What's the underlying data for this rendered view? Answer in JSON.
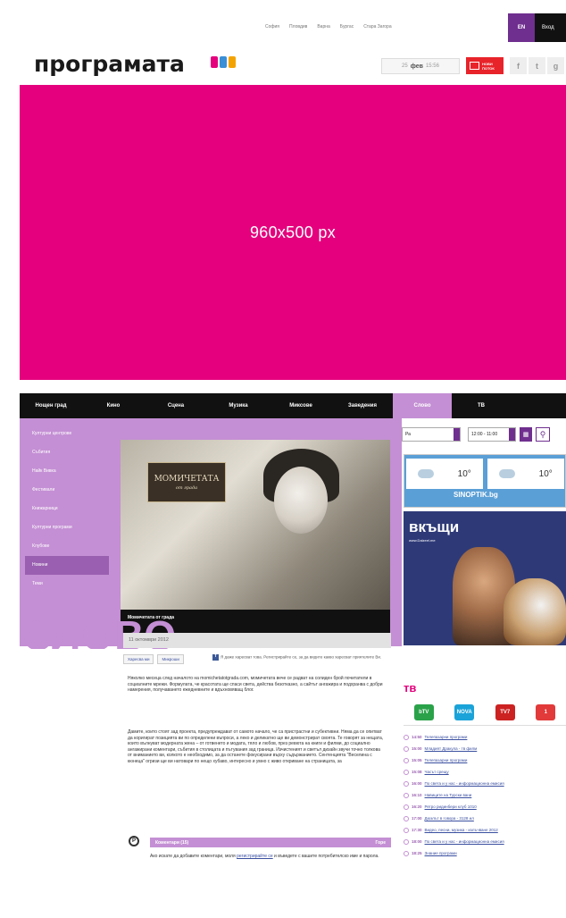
{
  "top_nav": {
    "links": [
      "София",
      "Пловдив",
      "Варна",
      "Бургас",
      "Стара Загора"
    ],
    "lang": "EN",
    "login": "Вход"
  },
  "header": {
    "logo": "програмата",
    "date_day": "25",
    "date_month": "фев",
    "date_time": "15:56",
    "news_label": "НОВИ ПОТОК",
    "social": [
      "f",
      "t",
      "g"
    ]
  },
  "banner": {
    "text": "960x500 px"
  },
  "main_nav": {
    "items": [
      {
        "label": "Нощен град",
        "w": 62
      },
      {
        "label": "Кино",
        "w": 60
      },
      {
        "label": "Сцена",
        "w": 60
      },
      {
        "label": "Музика",
        "w": 70
      },
      {
        "label": "Миксове",
        "w": 66
      },
      {
        "label": "Заведения",
        "w": 70
      },
      {
        "label": "Слово",
        "w": 66
      },
      {
        "label": "ТВ",
        "w": 70
      }
    ],
    "active": "Слово"
  },
  "section": {
    "big_word": "СЛОВО",
    "left_menu": [
      "Културни центрове",
      "Събития",
      "Найк Вивка",
      "Фестивали",
      "Книжарници",
      "Културни програми",
      "Клубове",
      "Новини",
      "Теми"
    ],
    "selected_menu": "Новини",
    "hero_sign_title": "МОМИЧЕТАТА",
    "hero_sign_sub": "от града",
    "hero_caption": "Момичетата от града"
  },
  "filter": {
    "select": "Ра",
    "time": "12:00 - 11:00"
  },
  "weather": {
    "temp1": "10°",
    "temp2": "10°",
    "brand": "SINOPTIK.bg"
  },
  "ad": {
    "title": "вкъщи",
    "site": "www.Dalzeel.me"
  },
  "article": {
    "date": "11 октомври 2012",
    "share_labels": [
      "Харесва ми",
      "Микроши"
    ],
    "fb_text": "Я даже харесват това. Регистрирайте се, за да видите какво харесват приятелите Ви.",
    "p1": "Няколко месеца след началото на momichetatotgrada.com, момичетата вече се радват на солиден брой почитатели в социалните мрежи. Формулата, че красотата ще спаси света, действа безотказно, а сайтът ангажира и подхранва с добри намерения, получаването ежедневните и вдъхновяващ блог.",
    "p2": "Дамите, които стоят зад проекта, предупреждават от самото начало, че са пристрастни и субективни. Няма да се опитват да коригират позицията ви по определени въпроси, а леко и деликатно ще ви демонстрират своята. Те говорят за нещата, които вълнуват модерната жена – от готвенето и модата, тяло и любов, през ревюта на книги и филми, до социално ангажирани коментари, събития в столицата и пътувания зад граница. Изчистеният и светъл дизайн звучи точно толкова от вниманието ви, колкото е необходимо, за да останете фокусирани върху съдържанието. Сентенцията \"Веселина с кюнеца\" огризи ще ви натовари по нещо хубаво, интересно и умно с живо откриване на страницата, за"
  },
  "comments": {
    "label": "Коментари (15)",
    "right": "Горе",
    "note_prefix": "Ако искате да добавите коментари, моля ",
    "note_link": "регистрирайте се",
    "note_suffix": " и въведете с вашите потребителско име и парола."
  },
  "tv": {
    "title": "тв",
    "channels": [
      {
        "label": "bTV",
        "color": "#2aa24a"
      },
      {
        "label": "NOVA",
        "color": "#1aa3d9"
      },
      {
        "label": "TV7",
        "color": "#cc2222"
      },
      {
        "label": "1",
        "color": "#e23a3a"
      }
    ],
    "schedule": [
      {
        "time": "14:50",
        "name": "Телепазарни програми"
      },
      {
        "time": "15:00",
        "name": "Младият Дракула - тв филм"
      },
      {
        "time": "15:05",
        "name": "Телепазарни програми"
      },
      {
        "time": "15:08",
        "name": "Часът срещу"
      },
      {
        "time": "16:00",
        "name": "По света и у нас - информационна емисия"
      },
      {
        "time": "16:10",
        "name": "Навиците на Турски вани"
      },
      {
        "time": "16:20",
        "name": "Ретро ридинбери клуб 1010"
      },
      {
        "time": "17:00",
        "name": "Дюэлът в говора - 3128 ил"
      },
      {
        "time": "17:30",
        "name": "Видео, песни, музика - излъчване 2012"
      },
      {
        "time": "18:00",
        "name": "По света и у нас - информационна емисия"
      },
      {
        "time": "18:25",
        "name": "Знание програми"
      }
    ]
  },
  "colors": {
    "brand_pink": "#e5007d",
    "purple": "#c48fd4",
    "dark_purple": "#6f2f8f"
  }
}
